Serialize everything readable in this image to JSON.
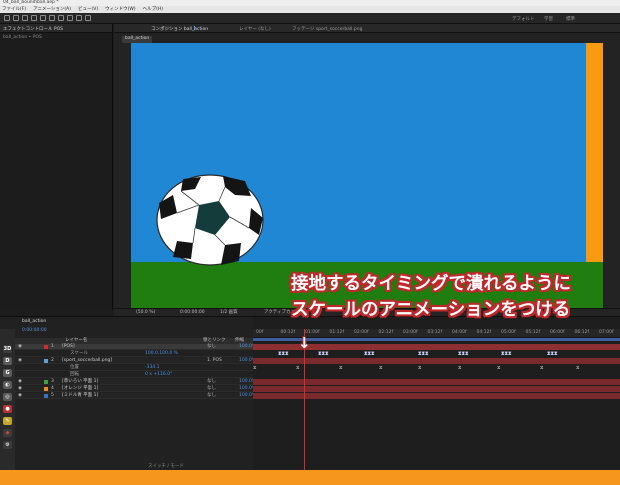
{
  "window": {
    "title": "04_ball_bound\\ball.aep *"
  },
  "menu": [
    "ファイル(F)",
    "アニメーション(A)",
    "ビュー(V)",
    "ウィンドウ(W)",
    "ヘルプ(H)"
  ],
  "toolbar": {
    "workspaces": [
      "デフォルト",
      "学習",
      "標準"
    ]
  },
  "left_panel": {
    "tab_label": "エフェクトコントロール POS",
    "breadcrumb": "ball_action • POS"
  },
  "viewer": {
    "tabs": [
      "コンポジション ball_action",
      "レイヤー (なし)",
      "フッテージ sport_soccerball.png"
    ],
    "comp_chip": "ball_action",
    "zoom": "(50.0 %)",
    "timecode": "0:00:00:00",
    "resolution": "1/2 画質",
    "camera": "アクティブカメラ"
  },
  "timeline": {
    "comp_tab": "ball_action",
    "timecode": "0:00:00:00",
    "column_header": "レイヤー名",
    "column_parent": "親とリンク",
    "column_stretch": "伸縮",
    "bottom_label": "スイッチ / モード",
    "ruler": [
      "00f",
      "00:12f",
      "01:00f",
      "01:12f",
      "02:00f",
      "02:12f",
      "03:00f",
      "03:12f",
      "04:00f",
      "04:12f",
      "05:00f",
      "05:12f",
      "06:00f",
      "06:12f",
      "07:00f"
    ],
    "layers": [
      {
        "num": "1",
        "name": "[POS]",
        "color": "#d32b2b",
        "parent": "なし",
        "stretch": "100.0%",
        "selected": true
      },
      {
        "num": "",
        "name": "スケール",
        "value": "100.0,100.0 %",
        "color": "",
        "parent": "",
        "stretch": ""
      },
      {
        "num": "2",
        "name": "[sport_soccerball.png]",
        "color": "#5aa0d8",
        "parent": "1. POS",
        "stretch": "100.0%"
      },
      {
        "num": "",
        "name": "位置",
        "value": "-334.1",
        "color": "",
        "parent": "",
        "stretch": ""
      },
      {
        "num": "",
        "name": "回転",
        "value": "0 x +116.0°",
        "color": "",
        "parent": "",
        "stretch": ""
      },
      {
        "num": "3",
        "name": "[草いろい 平面 1]",
        "color": "#3fa33f",
        "parent": "なし",
        "stretch": "100.0%"
      },
      {
        "num": "4",
        "name": "[オレンジ 平面 1]",
        "color": "#f08d1b",
        "parent": "なし",
        "stretch": "100.0%"
      },
      {
        "num": "5",
        "name": "[ミドル青 平面 1]",
        "color": "#3374c9",
        "parent": "なし",
        "stretch": "100.0%"
      }
    ],
    "scale_keyframes": [
      0.07,
      0.18,
      0.31,
      0.46,
      0.57,
      0.69,
      0.82
    ],
    "pos_keyframes": [
      0.0,
      0.12,
      0.24,
      0.35,
      0.46,
      0.57,
      0.68,
      0.8,
      0.9
    ],
    "playhead": 0.14
  },
  "caption": {
    "line1": "接地するタイミングで潰れるように",
    "line2": "スケールのアニメーションをつける"
  },
  "colors": {
    "sky": "#1f87d4",
    "grass": "#1f7e0f",
    "orange": "#f99a10",
    "caption_outline": "#c0282c"
  }
}
